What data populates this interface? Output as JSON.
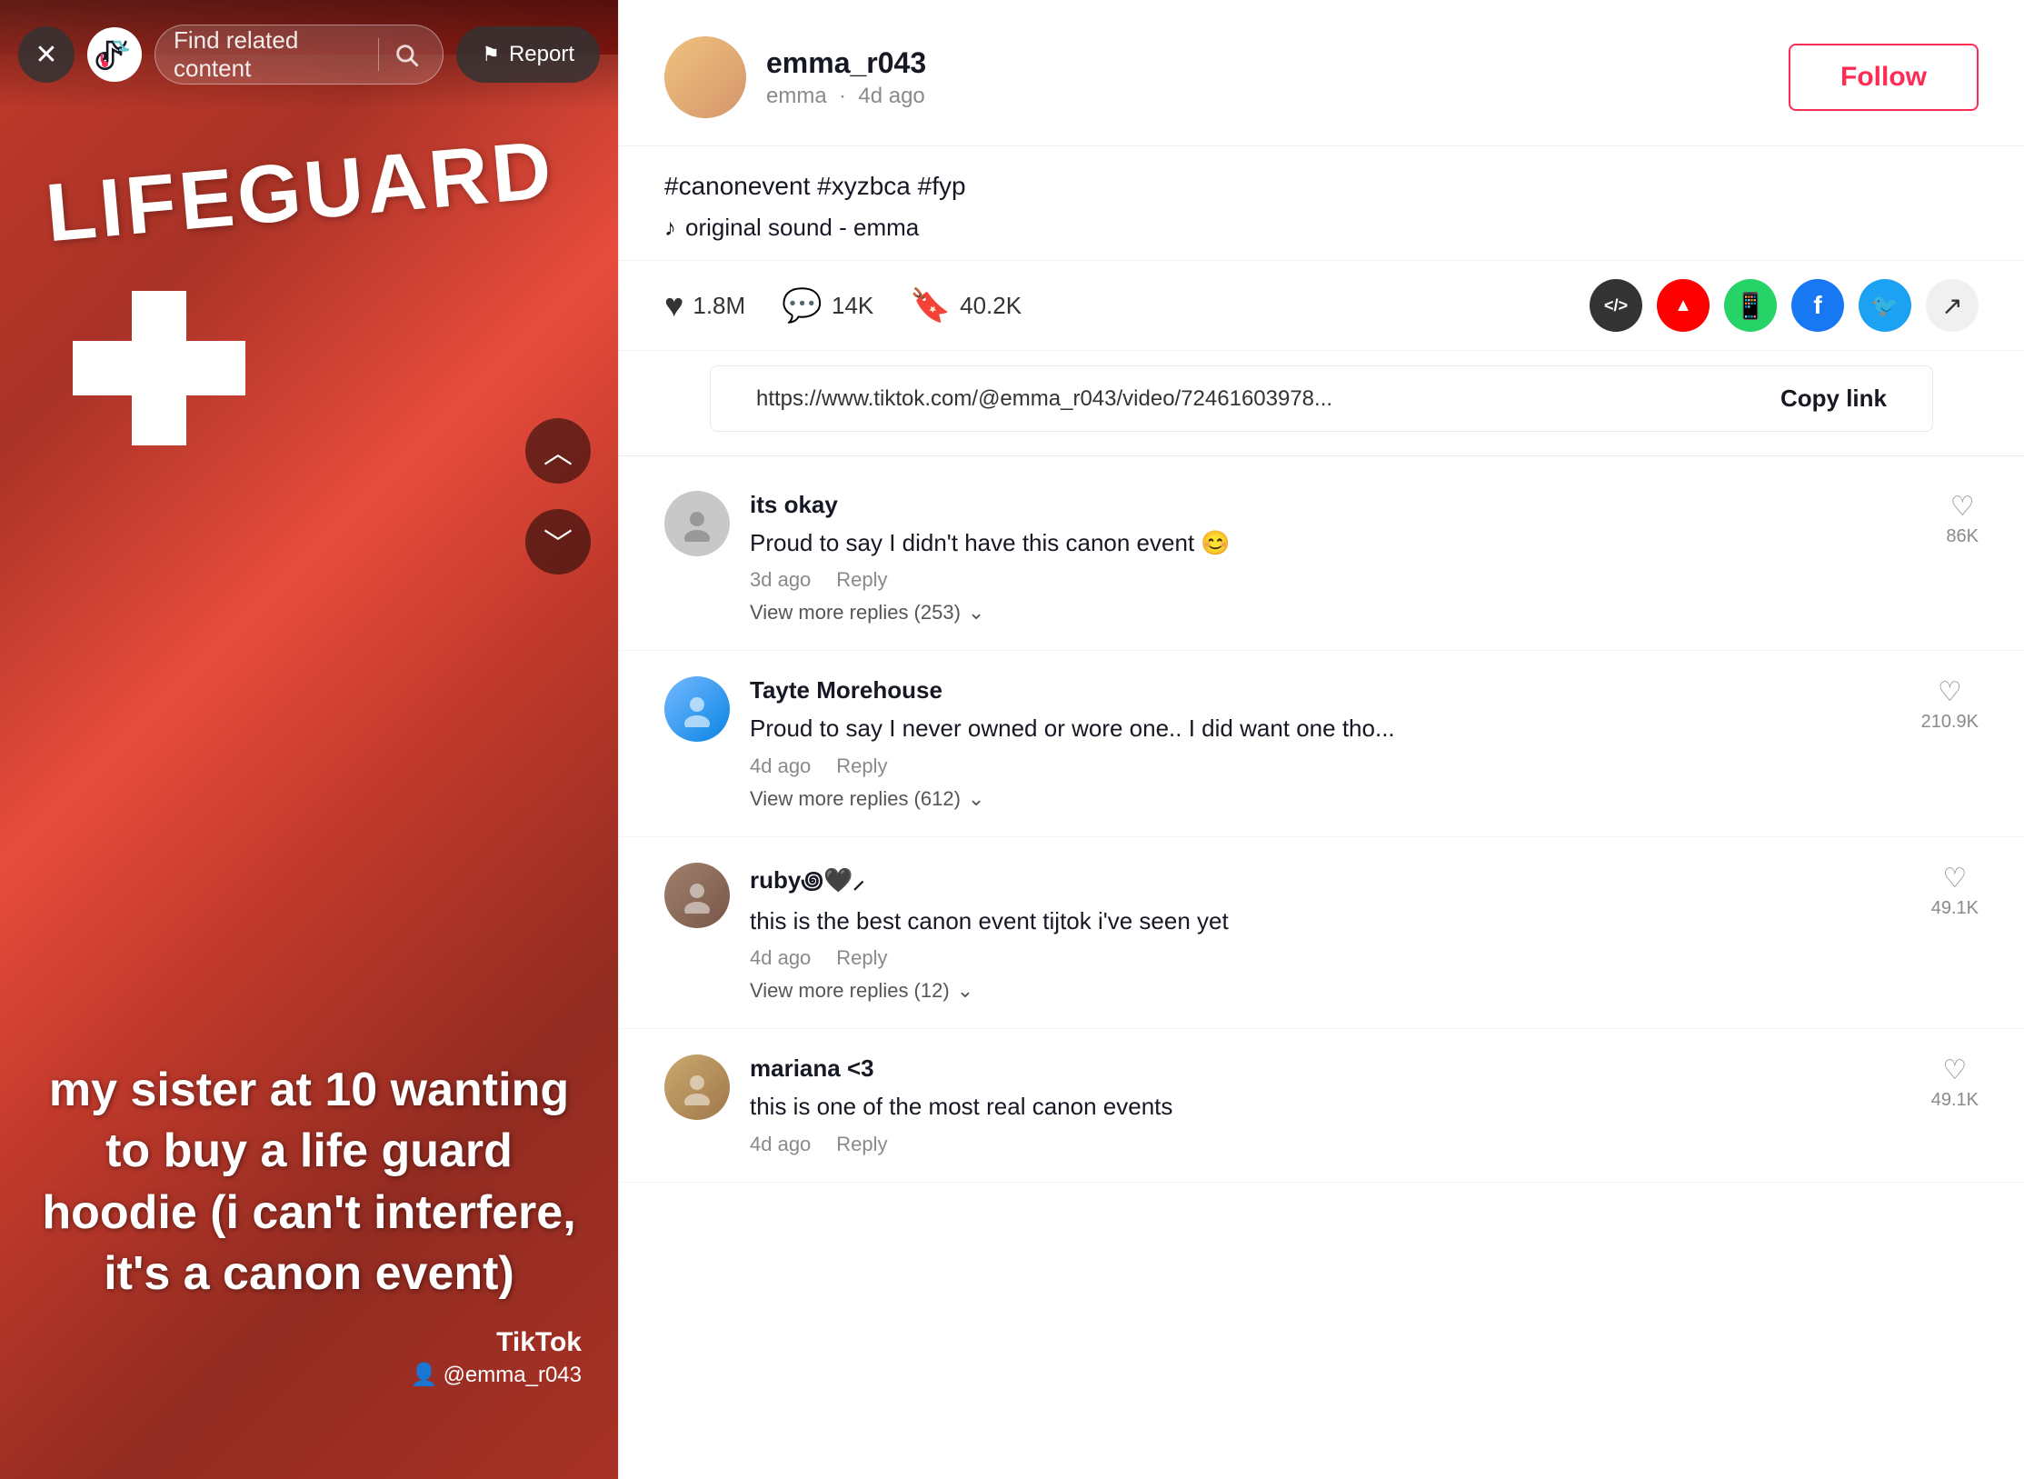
{
  "left": {
    "search_placeholder": "Find related content",
    "report_label": "Report",
    "caption": "my sister at 10 wanting to buy a life guard hoodie (i can't interfere, it's a canon event)",
    "tiktok_brand": "TikTok",
    "tiktok_user": "@emma_r043"
  },
  "right": {
    "username": "emma_r043",
    "display_name": "emma",
    "time_ago": "4d ago",
    "follow_label": "Follow",
    "hashtags": "#canonevent #xyzbca #fyp",
    "sound": "original sound - emma",
    "stats": {
      "likes": "1.8M",
      "comments": "14K",
      "bookmarks": "40.2K"
    },
    "link_url": "https://www.tiktok.com/@emma_r043/video/72461603978...",
    "copy_link_label": "Copy link"
  },
  "comments": [
    {
      "username": "its okay",
      "text": "Proud to say I didn't have this canon event 😊",
      "time": "3d ago",
      "reply_label": "Reply",
      "likes": "86K",
      "replies_count": "253",
      "view_replies_label": "View more replies (253)"
    },
    {
      "username": "Tayte Morehouse",
      "text": "Proud to say I never owned or wore one.. I did want one tho...",
      "time": "4d ago",
      "reply_label": "Reply",
      "likes": "210.9K",
      "replies_count": "612",
      "view_replies_label": "View more replies (612)"
    },
    {
      "username": "ruby꩜🖤⸝",
      "text": "this is the best canon event tijtok i've seen yet",
      "time": "4d ago",
      "reply_label": "Reply",
      "likes": "49.1K",
      "replies_count": "12",
      "view_replies_label": "View more replies (12)"
    },
    {
      "username": "mariana <3",
      "text": "this is one of the most real canon events",
      "time": "4d ago",
      "reply_label": "Reply",
      "likes": "49.1K",
      "replies_count": "",
      "view_replies_label": ""
    }
  ]
}
